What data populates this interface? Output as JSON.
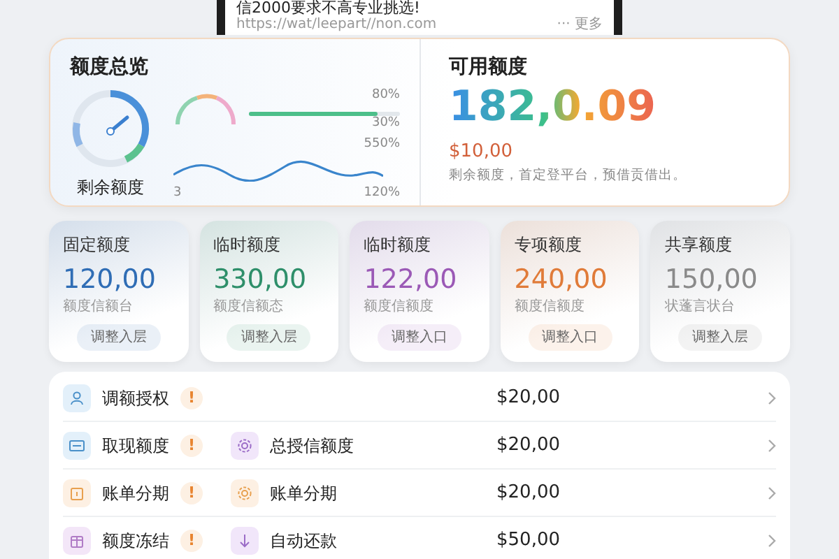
{
  "header": {
    "title": "信2000要求不高专业挑选!",
    "url": "https://wat/leepart//non.com",
    "more": "··· 更多"
  },
  "overview": {
    "title": "额度总览",
    "gauge_label": "剩余额度",
    "mini_labels": [
      "80%",
      "30%",
      "550%",
      "120%"
    ],
    "axis_label": "3",
    "available": {
      "title": "可用额度",
      "amount": "182,0.09",
      "sub_amount": "$10,00",
      "note": "剩余额度，首定登平台，预借贡借出。"
    }
  },
  "quota_cards": [
    {
      "title": "固定额度",
      "amount": "120,00",
      "desc": "额度信额台",
      "action": "调整入层",
      "color": "#2f6db5"
    },
    {
      "title": "临时额度",
      "amount": "330,00",
      "desc": "额度信额态",
      "action": "调整入层",
      "color": "#2e8f6a"
    },
    {
      "title": "临时额度",
      "amount": "122,00",
      "desc": "额度信额度",
      "action": "调整入口",
      "color": "#9b59b6"
    },
    {
      "title": "专项额度",
      "amount": "240,00",
      "desc": "额度信额度",
      "action": "调整入口",
      "color": "#e07b39"
    },
    {
      "title": "共享额度",
      "amount": "150,00",
      "desc": "状蓬言状台",
      "action": "调整入层",
      "color": "#8a8a8a"
    }
  ],
  "rows": [
    {
      "label": "调额授权",
      "alert": "!",
      "amount": "$20,00"
    },
    {
      "label": "取现额度",
      "alert": "!",
      "second": "总授信额度",
      "amount": "$20,00"
    },
    {
      "label": "账单分期",
      "alert": "!",
      "second": "账单分期",
      "amount": "$20,00"
    },
    {
      "label": "额度冻结",
      "alert": "!",
      "second": "自动还款",
      "amount": "$50,00"
    }
  ]
}
